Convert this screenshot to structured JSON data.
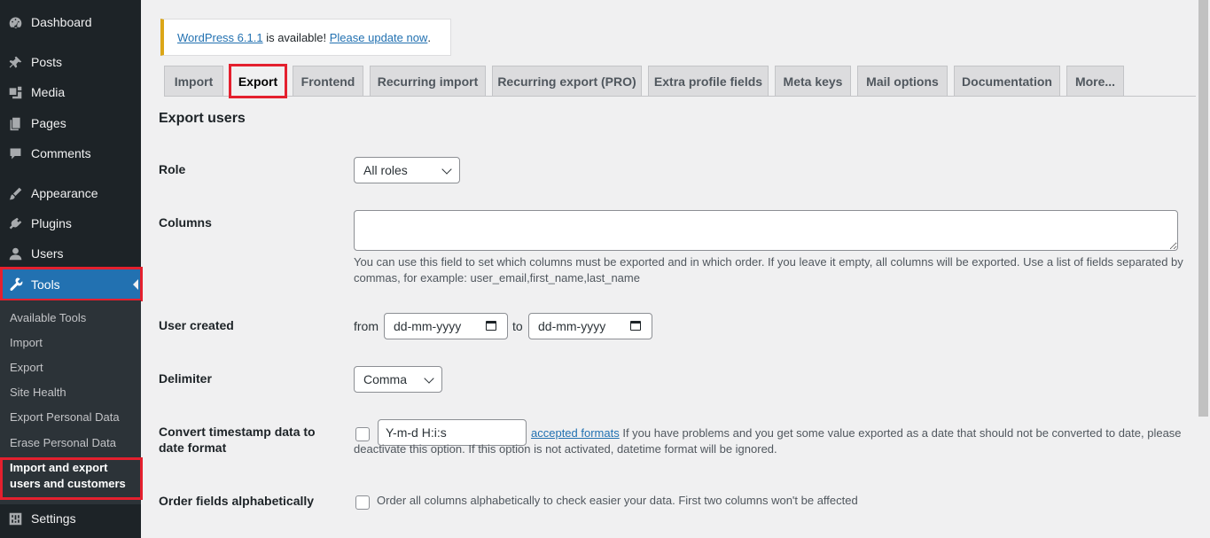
{
  "sidebar": {
    "items": [
      {
        "label": "Dashboard",
        "icon": "dashboard-icon"
      },
      {
        "label": "Posts",
        "icon": "pin-icon"
      },
      {
        "label": "Media",
        "icon": "media-icon"
      },
      {
        "label": "Pages",
        "icon": "pages-icon"
      },
      {
        "label": "Comments",
        "icon": "comment-icon"
      },
      {
        "label": "Appearance",
        "icon": "brush-icon"
      },
      {
        "label": "Plugins",
        "icon": "plugin-icon"
      },
      {
        "label": "Users",
        "icon": "user-icon"
      },
      {
        "label": "Tools",
        "icon": "wrench-icon"
      },
      {
        "label": "Settings",
        "icon": "settings-icon"
      }
    ],
    "submenu": [
      "Available Tools",
      "Import",
      "Export",
      "Site Health",
      "Export Personal Data",
      "Erase Personal Data",
      "Import and export users and customers"
    ]
  },
  "notice": {
    "version_link": "WordPress 6.1.1",
    "text": " is available! ",
    "update_link": "Please update now",
    "end": "."
  },
  "tabs": [
    "Import",
    "Export",
    "Frontend",
    "Recurring import",
    "Recurring export (PRO)",
    "Extra profile fields",
    "Meta keys",
    "Mail options",
    "Documentation",
    "More..."
  ],
  "form": {
    "title": "Export users",
    "role_label": "Role",
    "role_value": "All roles",
    "columns_label": "Columns",
    "columns_desc": "You can use this field to set which columns must be exported and in which order. If you leave it empty, all columns will be exported. Use a list of fields separated by commas, for example: user_email,first_name,last_name",
    "user_created_label": "User created",
    "from_label": "from",
    "to_label": "to",
    "date_placeholder": "dd-mm-yyyy",
    "delimiter_label": "Delimiter",
    "delimiter_value": "Comma",
    "timestamp_label": "Convert timestamp data to date format",
    "timestamp_format": "Y-m-d H:i:s",
    "accepted_formats_link": "accepted formats",
    "timestamp_desc": " If you have problems and you get some value exported as a date that should not be converted to date, please deactivate this option. If this option is not activated, datetime format will be ignored.",
    "order_label": "Order fields alphabetically",
    "order_desc": "Order all columns alphabetically to check easier your data. First two columns won't be affected"
  },
  "colors": {
    "sidebar_bg": "#1d2327",
    "active": "#2271b1",
    "highlight": "#e4202e",
    "notice_border": "#dba617"
  }
}
